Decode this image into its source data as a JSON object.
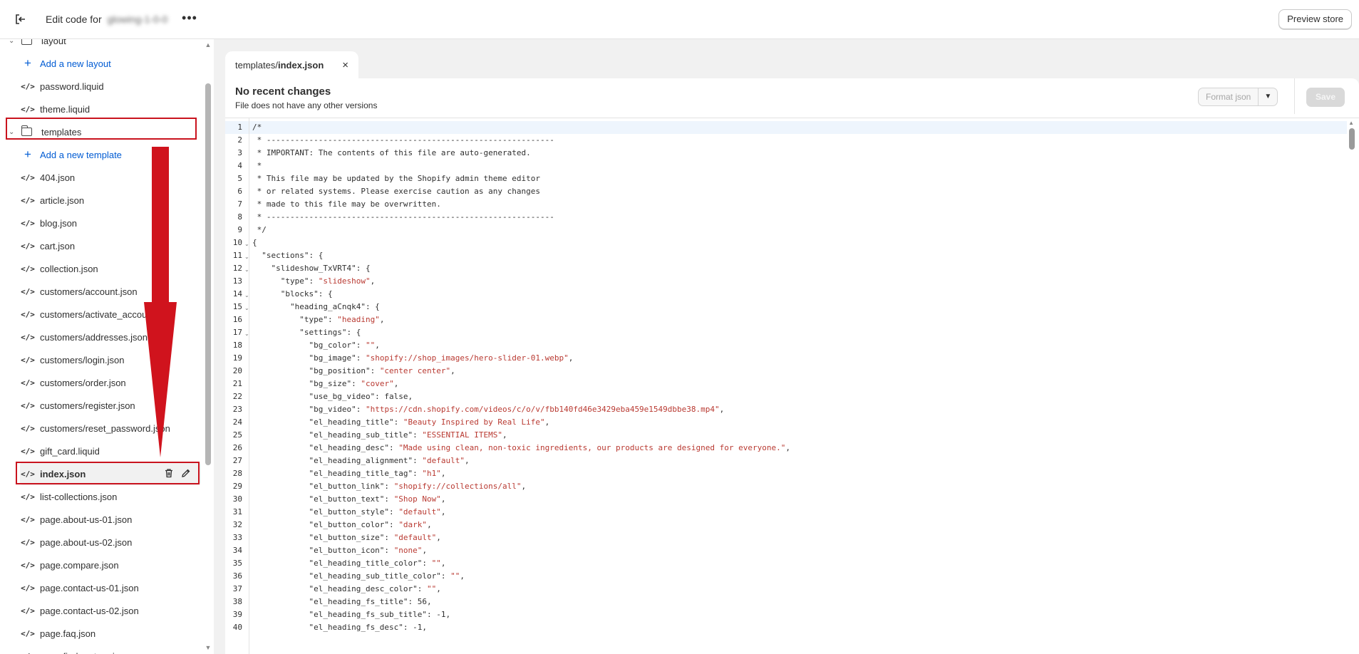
{
  "topbar": {
    "title_prefix": "Edit code for",
    "store_name": "glowing-1-0-0",
    "preview_label": "Preview store"
  },
  "sidebar": {
    "items": [
      {
        "kind": "folder",
        "label": "layout",
        "open": true
      },
      {
        "kind": "add",
        "label": "Add a new layout"
      },
      {
        "kind": "file",
        "label": "password.liquid"
      },
      {
        "kind": "file",
        "label": "theme.liquid"
      },
      {
        "kind": "folder",
        "label": "templates",
        "open": true
      },
      {
        "kind": "add",
        "label": "Add a new template"
      },
      {
        "kind": "file",
        "label": "404.json"
      },
      {
        "kind": "file",
        "label": "article.json"
      },
      {
        "kind": "file",
        "label": "blog.json"
      },
      {
        "kind": "file",
        "label": "cart.json"
      },
      {
        "kind": "file",
        "label": "collection.json"
      },
      {
        "kind": "file",
        "label": "customers/account.json"
      },
      {
        "kind": "file",
        "label": "customers/activate_account.json"
      },
      {
        "kind": "file",
        "label": "customers/addresses.json"
      },
      {
        "kind": "file",
        "label": "customers/login.json"
      },
      {
        "kind": "file",
        "label": "customers/order.json"
      },
      {
        "kind": "file",
        "label": "customers/register.json"
      },
      {
        "kind": "file",
        "label": "customers/reset_password.json"
      },
      {
        "kind": "file",
        "label": "gift_card.liquid"
      },
      {
        "kind": "file",
        "label": "index.json",
        "selected": true
      },
      {
        "kind": "file",
        "label": "list-collections.json"
      },
      {
        "kind": "file",
        "label": "page.about-us-01.json"
      },
      {
        "kind": "file",
        "label": "page.about-us-02.json"
      },
      {
        "kind": "file",
        "label": "page.compare.json"
      },
      {
        "kind": "file",
        "label": "page.contact-us-01.json"
      },
      {
        "kind": "file",
        "label": "page.contact-us-02.json"
      },
      {
        "kind": "file",
        "label": "page.faq.json"
      },
      {
        "kind": "file",
        "label": "page.find-a-store.json"
      }
    ],
    "file_icon": "</>"
  },
  "tab": {
    "folder": "templates/",
    "file": "index.json",
    "close": "×"
  },
  "editor": {
    "status_title": "No recent changes",
    "status_sub": "File does not have any other versions",
    "format_label": "Format json",
    "save_label": "Save",
    "lines": [
      [
        {
          "t": "/*"
        }
      ],
      [
        {
          "t": " * -------------------------------------------------------------"
        }
      ],
      [
        {
          "t": " * IMPORTANT: The contents of this file are auto-generated."
        }
      ],
      [
        {
          "t": " *"
        }
      ],
      [
        {
          "t": " * This file may be updated by the Shopify admin theme editor"
        }
      ],
      [
        {
          "t": " * or related systems. Please exercise caution as any changes"
        }
      ],
      [
        {
          "t": " * made to this file may be overwritten."
        }
      ],
      [
        {
          "t": " * -------------------------------------------------------------"
        }
      ],
      [
        {
          "t": " */"
        }
      ],
      [
        {
          "t": "{"
        }
      ],
      [
        {
          "t": "  \"sections\": {"
        }
      ],
      [
        {
          "t": "    \"slideshow_TxVRT4\": {"
        }
      ],
      [
        {
          "t": "      \"type\": "
        },
        {
          "t": "\"slideshow\"",
          "s": 1
        },
        {
          "t": ","
        }
      ],
      [
        {
          "t": "      \"blocks\": {"
        }
      ],
      [
        {
          "t": "        \"heading_aCnqk4\": {"
        }
      ],
      [
        {
          "t": "          \"type\": "
        },
        {
          "t": "\"heading\"",
          "s": 1
        },
        {
          "t": ","
        }
      ],
      [
        {
          "t": "          \"settings\": {"
        }
      ],
      [
        {
          "t": "            \"bg_color\": "
        },
        {
          "t": "\"\"",
          "s": 1
        },
        {
          "t": ","
        }
      ],
      [
        {
          "t": "            \"bg_image\": "
        },
        {
          "t": "\"shopify://shop_images/hero-slider-01.webp\"",
          "s": 1
        },
        {
          "t": ","
        }
      ],
      [
        {
          "t": "            \"bg_position\": "
        },
        {
          "t": "\"center center\"",
          "s": 1
        },
        {
          "t": ","
        }
      ],
      [
        {
          "t": "            \"bg_size\": "
        },
        {
          "t": "\"cover\"",
          "s": 1
        },
        {
          "t": ","
        }
      ],
      [
        {
          "t": "            \"use_bg_video\": false,"
        }
      ],
      [
        {
          "t": "            \"bg_video\": "
        },
        {
          "t": "\"https://cdn.shopify.com/videos/c/o/v/fbb140fd46e3429eba459e1549dbbe38.mp4\"",
          "s": 1
        },
        {
          "t": ","
        }
      ],
      [
        {
          "t": "            \"el_heading_title\": "
        },
        {
          "t": "\"Beauty Inspired by Real Life\"",
          "s": 1
        },
        {
          "t": ","
        }
      ],
      [
        {
          "t": "            \"el_heading_sub_title\": "
        },
        {
          "t": "\"ESSENTIAL ITEMS\"",
          "s": 1
        },
        {
          "t": ","
        }
      ],
      [
        {
          "t": "            \"el_heading_desc\": "
        },
        {
          "t": "\"Made using clean, non-toxic ingredients, our products are designed for everyone.\"",
          "s": 1
        },
        {
          "t": ","
        }
      ],
      [
        {
          "t": "            \"el_heading_alignment\": "
        },
        {
          "t": "\"default\"",
          "s": 1
        },
        {
          "t": ","
        }
      ],
      [
        {
          "t": "            \"el_heading_title_tag\": "
        },
        {
          "t": "\"h1\"",
          "s": 1
        },
        {
          "t": ","
        }
      ],
      [
        {
          "t": "            \"el_button_link\": "
        },
        {
          "t": "\"shopify://collections/all\"",
          "s": 1
        },
        {
          "t": ","
        }
      ],
      [
        {
          "t": "            \"el_button_text\": "
        },
        {
          "t": "\"Shop Now\"",
          "s": 1
        },
        {
          "t": ","
        }
      ],
      [
        {
          "t": "            \"el_button_style\": "
        },
        {
          "t": "\"default\"",
          "s": 1
        },
        {
          "t": ","
        }
      ],
      [
        {
          "t": "            \"el_button_color\": "
        },
        {
          "t": "\"dark\"",
          "s": 1
        },
        {
          "t": ","
        }
      ],
      [
        {
          "t": "            \"el_button_size\": "
        },
        {
          "t": "\"default\"",
          "s": 1
        },
        {
          "t": ","
        }
      ],
      [
        {
          "t": "            \"el_button_icon\": "
        },
        {
          "t": "\"none\"",
          "s": 1
        },
        {
          "t": ","
        }
      ],
      [
        {
          "t": "            \"el_heading_title_color\": "
        },
        {
          "t": "\"\"",
          "s": 1
        },
        {
          "t": ","
        }
      ],
      [
        {
          "t": "            \"el_heading_sub_title_color\": "
        },
        {
          "t": "\"\"",
          "s": 1
        },
        {
          "t": ","
        }
      ],
      [
        {
          "t": "            \"el_heading_desc_color\": "
        },
        {
          "t": "\"\"",
          "s": 1
        },
        {
          "t": ","
        }
      ],
      [
        {
          "t": "            \"el_heading_fs_title\": 56,"
        }
      ],
      [
        {
          "t": "            \"el_heading_fs_sub_title\": -1,"
        }
      ],
      [
        {
          "t": "            \"el_heading_fs_desc\": -1,"
        }
      ]
    ],
    "fold_lines": [
      10,
      11,
      12,
      14,
      15,
      17
    ],
    "active_line": 1
  },
  "colors": {
    "annotation": "#d0131d",
    "string": "#b93a32",
    "link": "#005bd3"
  }
}
